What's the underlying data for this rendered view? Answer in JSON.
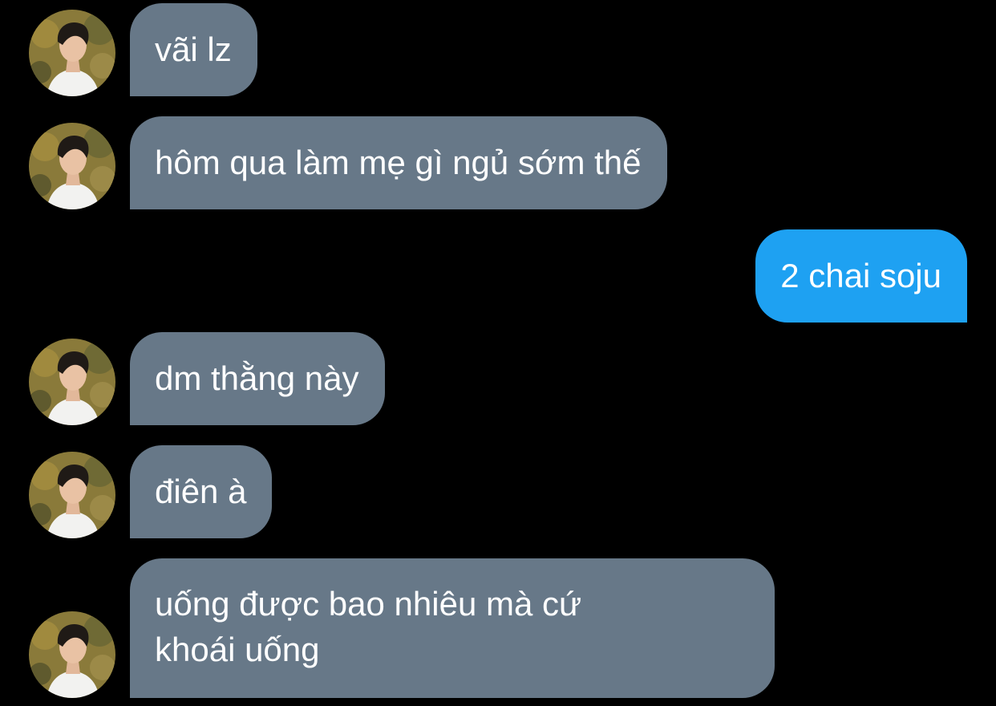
{
  "conversation": {
    "messages": [
      {
        "sender": "other",
        "text": "vãi lz"
      },
      {
        "sender": "other",
        "text": "hôm qua làm mẹ gì ngủ sớm thế"
      },
      {
        "sender": "me",
        "text": "2 chai soju"
      },
      {
        "sender": "other",
        "text": "dm thằng này"
      },
      {
        "sender": "other",
        "text": "điên à"
      },
      {
        "sender": "other",
        "lines": [
          "uống được bao nhiêu mà cứ",
          "khoái uống"
        ]
      }
    ]
  },
  "colors": {
    "background": "#000000",
    "incoming_bubble": "#677888",
    "outgoing_bubble": "#1ea1f2",
    "text": "#ffffff"
  },
  "icons": {
    "avatar": "contact-avatar-photo"
  }
}
